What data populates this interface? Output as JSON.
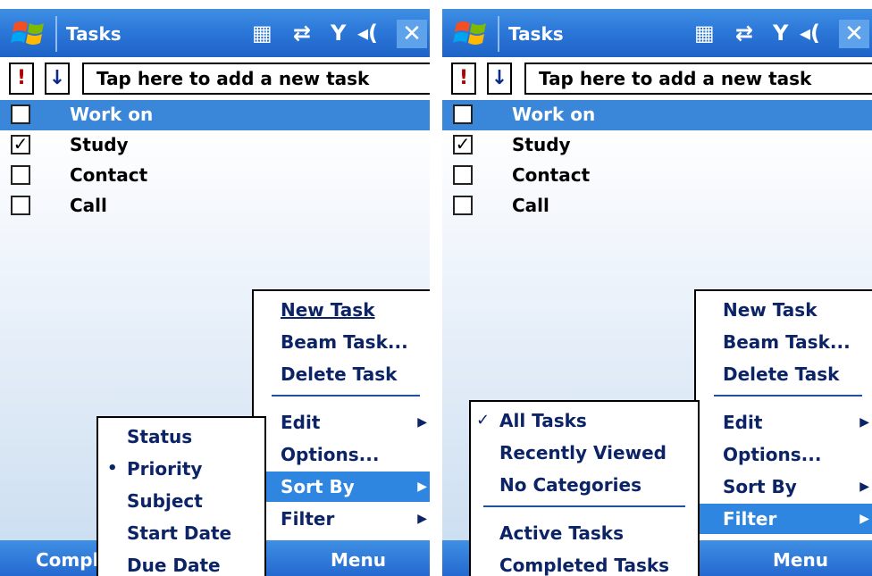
{
  "screens": [
    {
      "title": "Tasks",
      "add_placeholder": "Tap here to add a new task",
      "priority_button": "!",
      "sort_button": "↓",
      "tray": {
        "network": "▦",
        "sync": "⇄",
        "signal": "Y",
        "volume": "◂("
      },
      "close": "✕",
      "tasks": [
        {
          "label": "Work on",
          "checked": "",
          "selected": true
        },
        {
          "label": "Study",
          "checked": "✓"
        },
        {
          "label": "Contact",
          "checked": ""
        },
        {
          "label": "Call",
          "checked": ""
        }
      ],
      "softkeys": {
        "left": "Compl",
        "right": "Menu"
      },
      "menu": {
        "items_top": [
          "New Task",
          "Beam Task...",
          "Delete Task"
        ],
        "items_bottom": [
          "Edit",
          "Options...",
          "Sort By",
          "Filter"
        ],
        "highlighted": "Sort By"
      },
      "submenu": {
        "items": [
          "Status",
          "Priority",
          "Subject",
          "Start Date",
          "Due Date"
        ],
        "selected": "Priority",
        "mark": "•"
      }
    },
    {
      "title": "Tasks",
      "add_placeholder": "Tap here to add a new task",
      "priority_button": "!",
      "sort_button": "↓",
      "tray": {
        "network": "▦",
        "sync": "⇄",
        "signal": "Y",
        "volume": "◂("
      },
      "close": "✕",
      "tasks": [
        {
          "label": "Work on",
          "checked": "",
          "selected": true
        },
        {
          "label": "Study",
          "checked": "✓"
        },
        {
          "label": "Contact",
          "checked": ""
        },
        {
          "label": "Call",
          "checked": ""
        }
      ],
      "softkeys": {
        "left": "",
        "right": "Menu"
      },
      "menu": {
        "items_top": [
          "New Task",
          "Beam Task...",
          "Delete Task"
        ],
        "items_bottom": [
          "Edit",
          "Options...",
          "Sort By",
          "Filter"
        ],
        "highlighted": "Filter"
      },
      "submenu": {
        "items_top": [
          "All Tasks",
          "Recently Viewed",
          "No Categories"
        ],
        "items_bottom": [
          "Active Tasks",
          "Completed Tasks"
        ],
        "selected": "All Tasks",
        "mark": "✓"
      }
    }
  ],
  "colors": {
    "titlebar": "#2c78d9",
    "highlight": "#2f86e0",
    "menu_text": "#0c2466"
  }
}
